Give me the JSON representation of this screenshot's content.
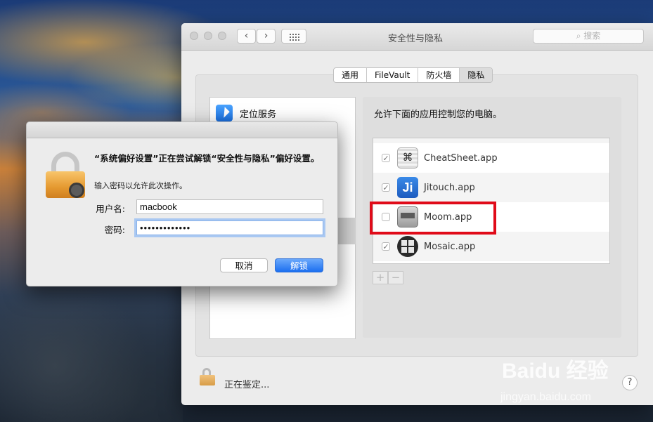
{
  "window": {
    "title": "安全性与隐私",
    "search_placeholder": "搜索",
    "tabs": [
      "通用",
      "FileVault",
      "防火墙",
      "隐私"
    ],
    "active_tab": "隐私",
    "left_list": [
      {
        "label": "定位服务",
        "icon": "location-arrow-icon"
      }
    ],
    "right_heading": "允许下面的应用控制您的电脑。",
    "apps": [
      {
        "name": "CheatSheet.app",
        "checked": true
      },
      {
        "name": "Jitouch.app",
        "checked": true
      },
      {
        "name": "Moom.app",
        "checked": false
      },
      {
        "name": "Mosaic.app",
        "checked": true
      }
    ],
    "add_label": "+",
    "remove_label": "−",
    "status": "正在鉴定...",
    "help": "?"
  },
  "dialog": {
    "title": "“系统偏好设置”正在尝试解锁“安全性与隐私”偏好设置。",
    "subtitle": "输入密码以允许此次操作。",
    "username_label": "用户名:",
    "username_value": "macbook",
    "password_label": "密码:",
    "password_value": "•••••••••••••",
    "cancel_label": "取消",
    "unlock_label": "解锁"
  },
  "watermark": {
    "brand": "Baidu 经验",
    "url": "jingyan.baidu.com"
  },
  "colors": {
    "accent": "#1c6ff0",
    "highlight_box": "#e00b19"
  }
}
